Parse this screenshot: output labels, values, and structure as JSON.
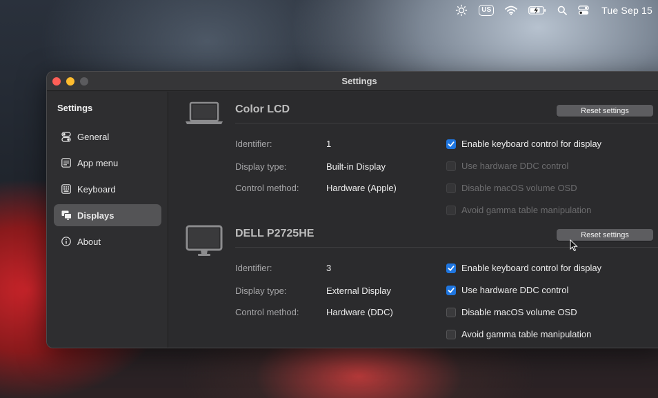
{
  "menubar": {
    "icons": [
      "brightness-icon",
      "input-source-icon",
      "wifi-icon",
      "battery-icon",
      "spotlight-icon",
      "control-center-icon"
    ],
    "input_source": "US",
    "clock": "Tue Sep 15"
  },
  "window": {
    "title": "Settings"
  },
  "sidebar": {
    "heading": "Settings",
    "items": [
      {
        "label": "General",
        "icon": "switches-icon",
        "active": false
      },
      {
        "label": "App menu",
        "icon": "menu-list-icon",
        "active": false
      },
      {
        "label": "Keyboard",
        "icon": "keyboard-icon",
        "active": false
      },
      {
        "label": "Displays",
        "icon": "displays-icon",
        "active": true
      },
      {
        "label": "About",
        "icon": "info-icon",
        "active": false
      }
    ]
  },
  "displays": [
    {
      "name": "Color LCD",
      "icon": "laptop-icon",
      "reset_label": "Reset settings",
      "rows": [
        {
          "label": "Identifier:",
          "value": "1"
        },
        {
          "label": "Display type:",
          "value": "Built-in Display"
        },
        {
          "label": "Control method:",
          "value": "Hardware (Apple)"
        }
      ],
      "options": [
        {
          "label": "Enable keyboard control for display",
          "checked": true,
          "disabled": false
        },
        {
          "label": "Use hardware DDC control",
          "checked": false,
          "disabled": true
        },
        {
          "label": "Disable macOS volume OSD",
          "checked": false,
          "disabled": true
        },
        {
          "label": "Avoid gamma table manipulation",
          "checked": false,
          "disabled": true
        }
      ]
    },
    {
      "name": "DELL P2725HE",
      "icon": "monitor-icon",
      "reset_label": "Reset settings",
      "rows": [
        {
          "label": "Identifier:",
          "value": "3"
        },
        {
          "label": "Display type:",
          "value": "External Display"
        },
        {
          "label": "Control method:",
          "value": "Hardware (DDC)"
        }
      ],
      "options": [
        {
          "label": "Enable keyboard control for display",
          "checked": true,
          "disabled": false
        },
        {
          "label": "Use hardware DDC control",
          "checked": true,
          "disabled": false
        },
        {
          "label": "Disable macOS volume OSD",
          "checked": false,
          "disabled": false
        },
        {
          "label": "Avoid gamma table manipulation",
          "checked": false,
          "disabled": false
        }
      ]
    }
  ],
  "colors": {
    "accent": "#1f76e0",
    "window_bg": "#2c2c2e",
    "sidebar_active": "#545456"
  }
}
